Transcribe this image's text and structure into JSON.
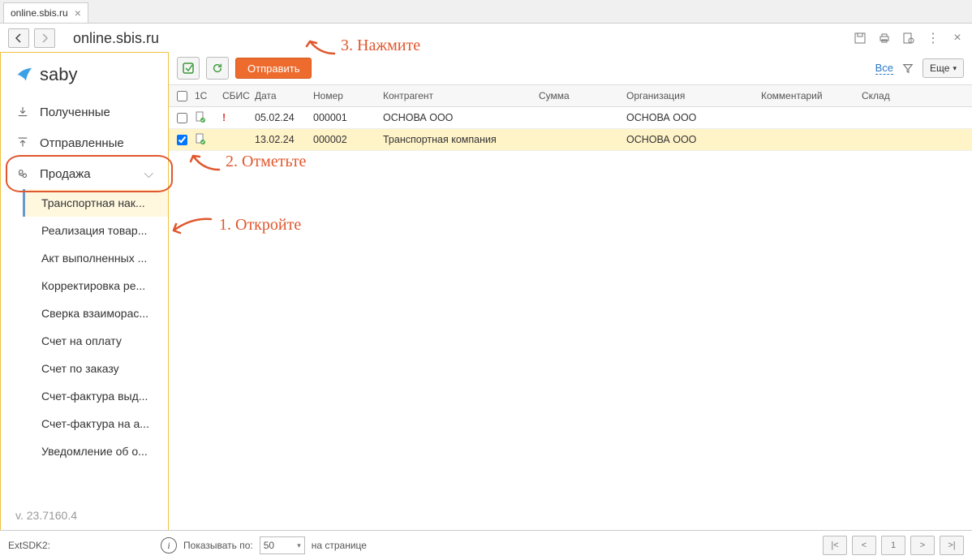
{
  "tab": {
    "title": "online.sbis.ru"
  },
  "address": "online.sbis.ru",
  "brand": "saby",
  "nav": {
    "received": "Полученные",
    "sent": "Отправленные",
    "sale": "Продажа"
  },
  "sale_items": [
    "Транспортная нак...",
    "Реализация товар...",
    "Акт выполненных ...",
    "Корректировка ре...",
    "Сверка взаиморас...",
    "Счет на оплату",
    "Счет по заказу",
    "Счет-фактура выд...",
    "Счет-фактура на а...",
    "Уведомление об о..."
  ],
  "version": "v. 23.7160.4",
  "toolbar": {
    "send": "Отправить",
    "all": "Все",
    "more": "Еще"
  },
  "columns": {
    "c1c": "1С",
    "sbis": "СБИС",
    "date": "Дата",
    "num": "Номер",
    "contr": "Контрагент",
    "sum": "Сумма",
    "org": "Организация",
    "comm": "Комментарий",
    "skl": "Склад"
  },
  "rows": [
    {
      "checked": false,
      "alert": true,
      "date": "05.02.24",
      "num": "000001",
      "contr": "ОСНОВА ООО",
      "sum": "",
      "org": "ОСНОВА ООО"
    },
    {
      "checked": true,
      "alert": false,
      "date": "13.02.24",
      "num": "000002",
      "contr": "Транспортная компания",
      "sum": "",
      "org": "ОСНОВА ООО"
    }
  ],
  "annotations": {
    "open": "1. Откройте",
    "mark": "2. Отметьте",
    "press": "3. Нажмите"
  },
  "footer": {
    "sdk": "ExtSDK2:",
    "show": "Показывать по:",
    "per": "50",
    "onpage": "на странице",
    "page": "1"
  }
}
